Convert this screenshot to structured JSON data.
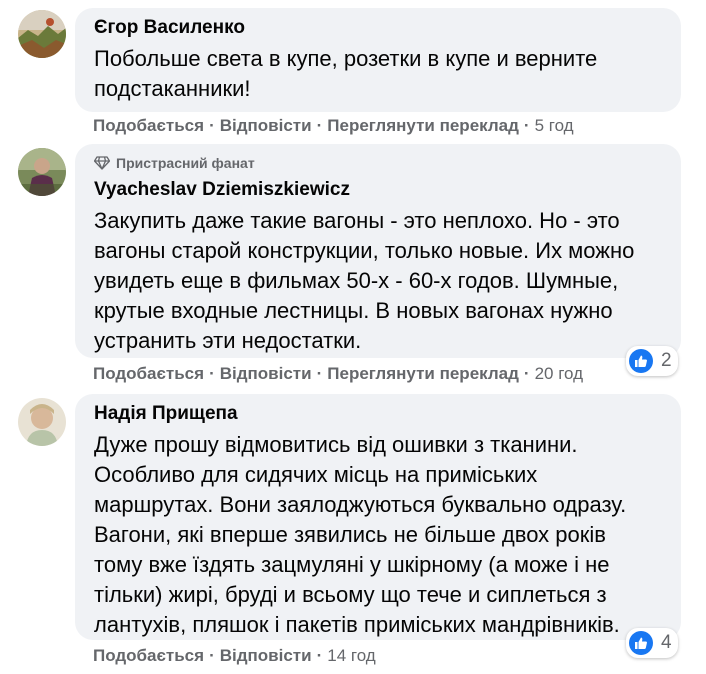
{
  "actions": {
    "like": "Подобається",
    "reply": "Відповісти",
    "translate": "Переглянути переклад",
    "separator": "·"
  },
  "comments": [
    {
      "author": "Єгор Василенко",
      "lines": [
        "Побольше света в купе, розетки в купе и верните",
        "подстаканники!"
      ],
      "time": "5 год"
    },
    {
      "badge": "Пристрасний фанат",
      "author": "Vyacheslav Dziemiszkiewicz",
      "lines": [
        "Закупить даже такие вагоны - это неплохо. Но - это",
        "вагоны старой конструкции, только новые. Их можно",
        "увидеть еще в фильмах 50-х - 60-х годов. Шумные,",
        "крутые входные лестницы. В новых вагонах нужно",
        "устранить эти недостатки."
      ],
      "time": "20 год",
      "reaction_count": "2",
      "reaction_icon": "like-icon"
    },
    {
      "author": "Надія Прищепа",
      "lines": [
        "Дуже прошу відмовитись від ошивки з тканини.",
        "Особливо для сидячих місць на приміських",
        "маршрутах. Вони заялоджуються буквально одразу.",
        "Вагони, які вперше зявились не більше двох років",
        "тому вже їздять зацмуляні у шкірному (а може і не",
        "тільки) жирі, бруді и всьому що тече и сиплеться з",
        "лантухів, пляшок і пакетів приміських мандрівників."
      ],
      "time": "14 год",
      "reaction_count": "4",
      "reaction_icon": "like-icon"
    }
  ],
  "colors": {
    "bubble_bg": "#f0f2f5",
    "secondary_text": "#65676b",
    "like_blue": "#1877f2"
  }
}
